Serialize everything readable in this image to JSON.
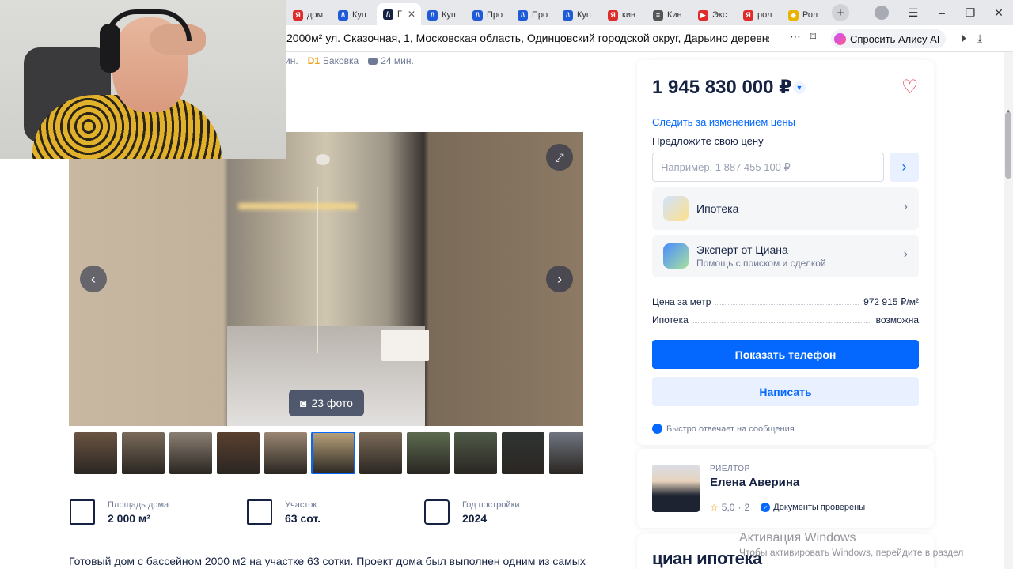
{
  "browser": {
    "tabs": [
      {
        "label": "дом",
        "color": "#e02b2b",
        "glyph": "Я"
      },
      {
        "label": "Куп",
        "color": "#1f5bd8",
        "glyph": "/\\"
      },
      {
        "label": "Г",
        "color": "#152242",
        "glyph": "/\\",
        "active": true
      },
      {
        "label": "Куп",
        "color": "#1f5bd8",
        "glyph": "/\\"
      },
      {
        "label": "Про",
        "color": "#1f5bd8",
        "glyph": "/\\"
      },
      {
        "label": "Про",
        "color": "#1f5bd8",
        "glyph": "/\\"
      },
      {
        "label": "Куп",
        "color": "#1f5bd8",
        "glyph": "/\\"
      },
      {
        "label": "кин",
        "color": "#e02b2b",
        "glyph": "Я"
      },
      {
        "label": "Кин",
        "color": "#555555",
        "glyph": "≡"
      },
      {
        "label": "Экс",
        "color": "#e02b2b",
        "glyph": "▶"
      },
      {
        "label": "рол",
        "color": "#e02b2b",
        "glyph": "Я"
      },
      {
        "label": "Рол",
        "color": "#e8b400",
        "glyph": "◆"
      }
    ],
    "url": "2000м² ул. Сказочная, 1, Московская область, Одинцовский городской округ, Дарьино деревня, Дарьи...",
    "alice_label": "Спросить Алису AI"
  },
  "transport": {
    "walk": "ин.",
    "station_line": "D1",
    "station": "Баковка",
    "drive": "24 мин."
  },
  "gallery": {
    "photo_count": "23 фото",
    "thumbs": [
      {
        "color": "#6b5342"
      },
      {
        "color": "#7a6a5a"
      },
      {
        "color": "#8b7f73"
      },
      {
        "color": "#5a4030"
      },
      {
        "color": "#9a8672"
      },
      {
        "color": "#b8a27a",
        "selected": true
      },
      {
        "color": "#7b6a58"
      },
      {
        "color": "#5c6b4f"
      },
      {
        "color": "#4f5a47"
      },
      {
        "color": "#2f3432"
      },
      {
        "color": "#6f7580"
      }
    ]
  },
  "stats": [
    {
      "label": "Площадь дома",
      "value": "2 000 м²",
      "icon": "area-icon"
    },
    {
      "label": "Участок",
      "value": "63 сот.",
      "icon": "plot-icon"
    },
    {
      "label": "Год постройки",
      "value": "2024",
      "icon": "calendar-icon"
    }
  ],
  "description": "Готовый дом с бассейном 2000 м2 на участке 63 сотки. Проект дома был выполнен одним из самых",
  "offer": {
    "price": "1 945 830 000 ₽",
    "track_price": "Следить за изменением цены",
    "suggest_label": "Предложите свою цену",
    "suggest_placeholder": "Например, 1 887 455 100 ₽",
    "mortgage_title": "Ипотека",
    "expert_title": "Эксперт от Циана",
    "expert_sub": "Помощь с поиском и сделкой",
    "price_per_m_key": "Цена за метр",
    "price_per_m_val": "972 915 ₽/м²",
    "mortgage_key": "Ипотека",
    "mortgage_val": "возможна",
    "show_phone": "Показать телефон",
    "write": "Написать",
    "fast_reply": "Быстро отвечает на сообщения"
  },
  "realtor": {
    "role": "РИЕЛТОР",
    "name": "Елена Аверина",
    "rating": "5,0",
    "reviews": "2",
    "verified": "Документы проверены"
  },
  "ipoteka_logo": "циан ипотека",
  "windows": {
    "title": "Активация Windows",
    "subtitle": "Чтобы активировать Windows, перейдите в раздел"
  }
}
